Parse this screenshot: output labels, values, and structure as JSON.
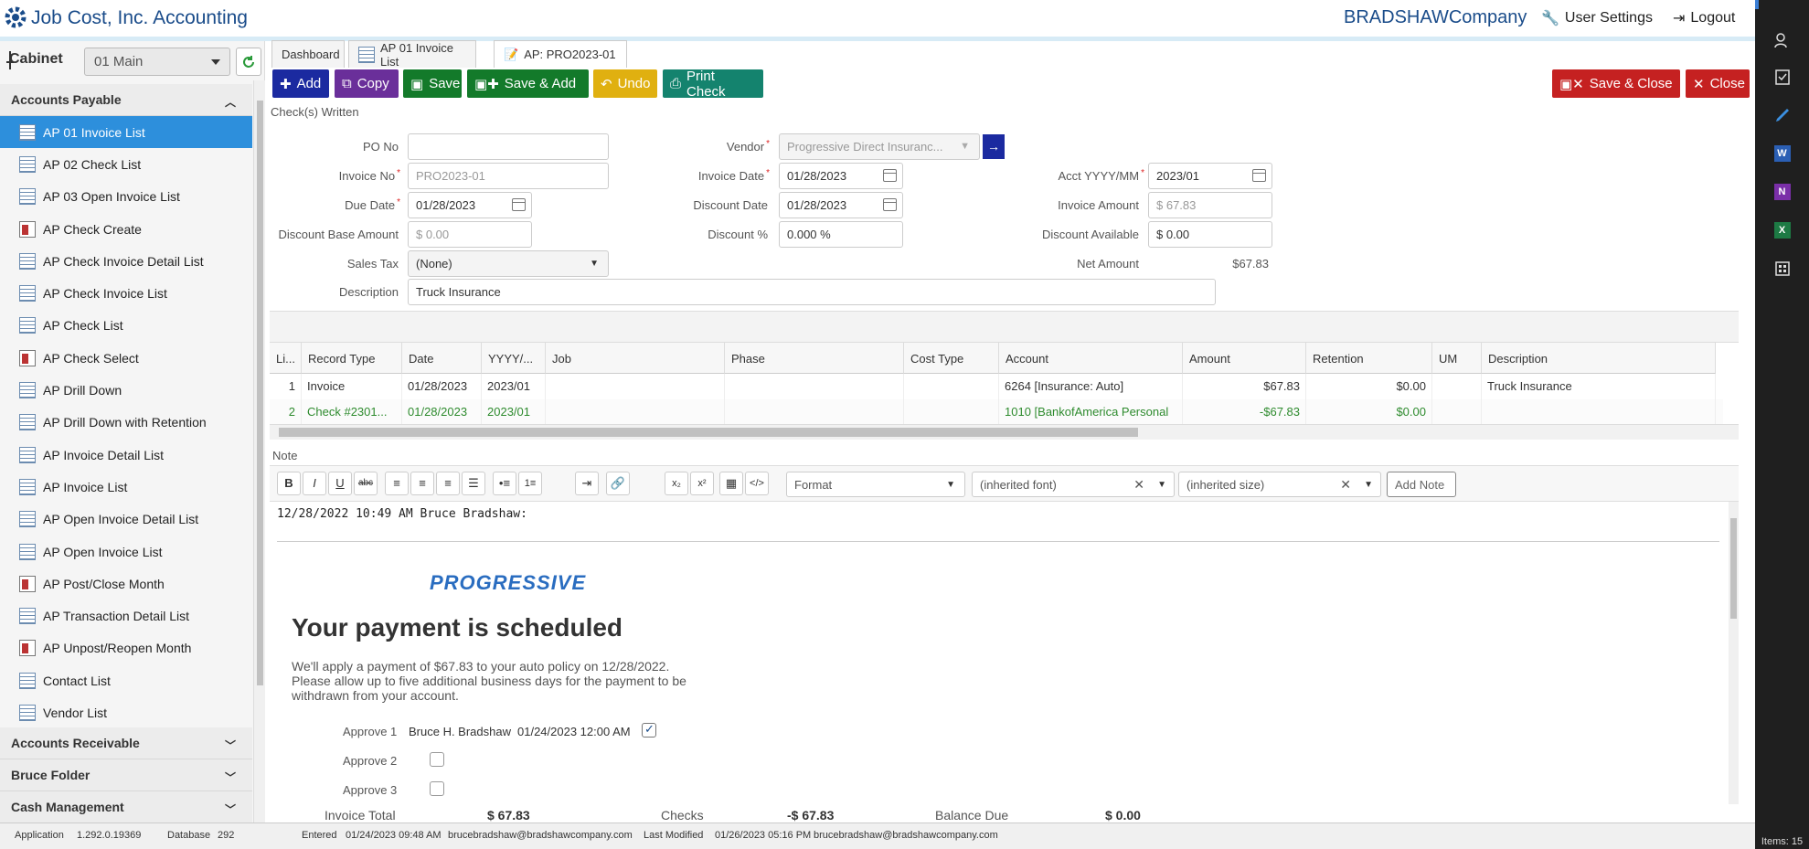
{
  "header": {
    "app_title": "Job Cost, Inc. Accounting",
    "company": "BRADSHAWCompany",
    "user_settings": "User Settings",
    "logout": "Logout"
  },
  "rail": {
    "items_label": "Items: 15"
  },
  "sidebar": {
    "cabinet_label": "Cabinet",
    "cabinet_value": "01 Main",
    "group_accounts_payable": "Accounts Payable",
    "items": [
      {
        "label": "AP 01 Invoice List",
        "icon": "list-icon"
      },
      {
        "label": "AP 02 Check List",
        "icon": "list-icon"
      },
      {
        "label": "AP 03 Open Invoice List",
        "icon": "list-icon"
      },
      {
        "label": "AP Check Create",
        "icon": "form-icon"
      },
      {
        "label": "AP Check Invoice Detail List",
        "icon": "list-icon"
      },
      {
        "label": "AP Check Invoice List",
        "icon": "list-icon"
      },
      {
        "label": "AP Check List",
        "icon": "list-icon"
      },
      {
        "label": "AP Check Select",
        "icon": "form-icon"
      },
      {
        "label": "AP Drill Down",
        "icon": "list-icon"
      },
      {
        "label": "AP Drill Down with Retention",
        "icon": "list-icon"
      },
      {
        "label": "AP Invoice Detail List",
        "icon": "list-icon"
      },
      {
        "label": "AP Invoice List",
        "icon": "list-icon"
      },
      {
        "label": "AP Open Invoice Detail List",
        "icon": "list-icon"
      },
      {
        "label": "AP Open Invoice List",
        "icon": "list-icon"
      },
      {
        "label": "AP Post/Close Month",
        "icon": "form-icon"
      },
      {
        "label": "AP Transaction Detail List",
        "icon": "list-icon"
      },
      {
        "label": "AP Unpost/Reopen Month",
        "icon": "form-icon"
      },
      {
        "label": "Contact List",
        "icon": "list-icon"
      },
      {
        "label": "Vendor List",
        "icon": "list-icon"
      }
    ],
    "groups_below": [
      "Accounts Receivable",
      "Bruce Folder",
      "Cash Management"
    ]
  },
  "status": {
    "application_label": "Application",
    "application_version": "1.292.0.19369",
    "database_label": "Database",
    "database_value": "292",
    "entered_label": "Entered",
    "entered_value": "01/24/2023 09:48 AM",
    "entered_by": "brucebradshaw@bradshawcompany.com",
    "modified_label": "Last Modified",
    "modified_value": "01/26/2023 05:16 PM",
    "modified_by": "brucebradshaw@bradshawcompany.com"
  },
  "tabs": [
    {
      "label": "Dashboard"
    },
    {
      "label": "AP 01 Invoice List"
    },
    {
      "label": "AP: PRO2023-01"
    }
  ],
  "toolbar": {
    "add": "Add",
    "copy": "Copy",
    "save": "Save",
    "save_add": "Save & Add",
    "undo": "Undo",
    "print_check": "Print Check",
    "save_close": "Save & Close",
    "close": "Close"
  },
  "form": {
    "checks_written": "Check(s) Written",
    "po_no_label": "PO No",
    "po_no_value": "",
    "vendor_label": "Vendor",
    "vendor_value": "Progressive Direct Insuranc...",
    "invoice_no_label": "Invoice No",
    "invoice_no_value": "PRO2023-01",
    "invoice_date_label": "Invoice Date",
    "invoice_date_value": "01/28/2023",
    "acct_label": "Acct YYYY/MM",
    "acct_value": "2023/01",
    "due_date_label": "Due Date",
    "due_date_value": "01/28/2023",
    "discount_date_label": "Discount Date",
    "discount_date_value": "01/28/2023",
    "invoice_amount_label": "Invoice Amount",
    "invoice_amount_value": "$ 67.83",
    "discount_base_label": "Discount Base Amount",
    "discount_base_value": "$ 0.00",
    "discount_pct_label": "Discount %",
    "discount_pct_value": "0.000 %",
    "discount_avail_label": "Discount Available",
    "discount_avail_value": "$ 0.00",
    "sales_tax_label": "Sales Tax",
    "sales_tax_value": "(None)",
    "net_amount_label": "Net Amount",
    "net_amount_value": "$67.83",
    "description_label": "Description",
    "description_value": "Truck Insurance"
  },
  "grid": {
    "columns": [
      "Li...",
      "Record Type",
      "Date",
      "YYYY/...",
      "Job",
      "Phase",
      "Cost Type",
      "Account",
      "Amount",
      "Retention",
      "UM",
      "Description"
    ],
    "rows": [
      {
        "line": "1",
        "record_type": "Invoice",
        "date": "01/28/2023",
        "period": "2023/01",
        "job": "",
        "phase": "",
        "cost_type": "",
        "account": "6264 [Insurance: Auto]",
        "amount": "$67.83",
        "retention": "$0.00",
        "um": "",
        "description": "Truck Insurance"
      },
      {
        "line": "2",
        "record_type": "Check #2301...",
        "date": "01/28/2023",
        "period": "2023/01",
        "job": "",
        "phase": "",
        "cost_type": "",
        "account": "1010 [BankofAmerica Personal",
        "amount": "-$67.83",
        "retention": "$0.00",
        "um": "",
        "description": ""
      }
    ]
  },
  "note": {
    "label": "Note",
    "format_placeholder": "Format",
    "font_value": "(inherited font)",
    "size_value": "(inherited size)",
    "add_note": "Add Note",
    "entry_header": "12/28/2022 10:49 AM Bruce Bradshaw:",
    "logo_text": "PROGRESSIVE",
    "headline": "Your payment is scheduled",
    "body": "We'll apply a payment of $67.83 to your auto policy on 12/28/2022. Please allow up to five additional business days for the payment to be withdrawn from your account."
  },
  "approvals": [
    {
      "label": "Approve 1",
      "name": "Bruce H. Bradshaw",
      "date": "01/24/2023 12:00 AM",
      "checked": true
    },
    {
      "label": "Approve 2",
      "checked": false
    },
    {
      "label": "Approve 3",
      "checked": false
    }
  ],
  "totals": {
    "invoice_total_label": "Invoice Total",
    "invoice_total_value": "$ 67.83",
    "checks_label": "Checks",
    "checks_value": "-$ 67.83",
    "balance_label": "Balance Due",
    "balance_value": "$ 0.00"
  },
  "colors": {
    "accent": "#2d8fdc",
    "brand": "#1a4c8a",
    "green_row": "#2e8b2e",
    "close_red": "#c52121"
  }
}
